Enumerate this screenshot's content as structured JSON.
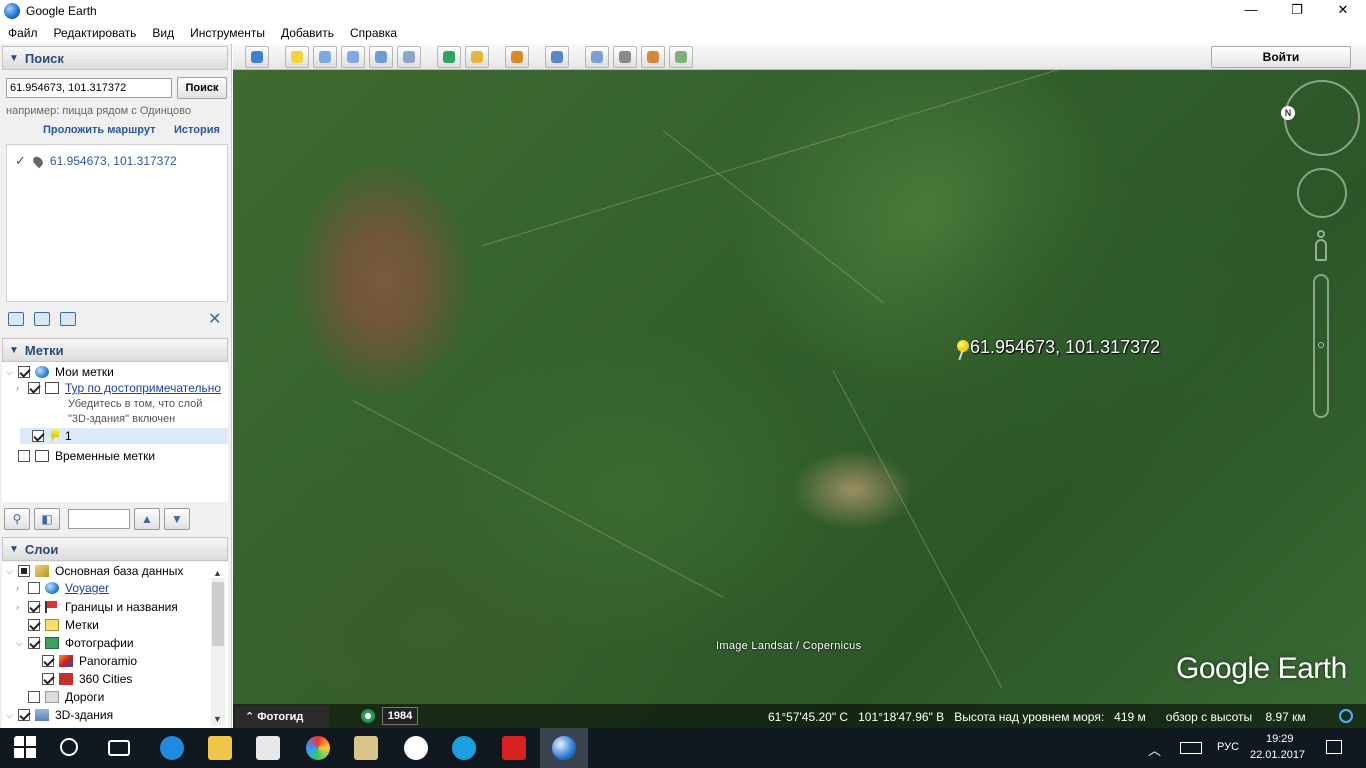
{
  "window": {
    "title": "Google Earth",
    "minimize": "—",
    "maximize": "❐",
    "close": "✕"
  },
  "menu": [
    "Файл",
    "Редактировать",
    "Вид",
    "Инструменты",
    "Добавить",
    "Справка"
  ],
  "search": {
    "header": "Поиск",
    "value": "61.954673, 101.317372",
    "button": "Поиск",
    "hint": "например: пицца рядом с Одинцово",
    "route_link": "Проложить маршрут",
    "history_link": "История",
    "result": "61.954673, 101.317372"
  },
  "places": {
    "header": "Метки",
    "my_places": "Мои метки",
    "tour_link": "Тур по достопримечательно",
    "tour_note_1": "Убедитесь в том, что слой",
    "tour_note_2": "\"3D-здания\" включен",
    "item_1": "1",
    "temporary": "Временные метки"
  },
  "layers": {
    "header": "Слои",
    "items": [
      "Основная база данных",
      "Voyager",
      "Границы и названия",
      "Метки",
      "Фотографии",
      "Panoramio",
      "360 Cities",
      "Дороги",
      "3D-здания"
    ]
  },
  "toolbar": {
    "login": "Войти"
  },
  "map": {
    "placemark_label": "61.954673, 101.317372",
    "attribution": "Image Landsat / Copernicus",
    "brand": "Google Earth",
    "north": "N"
  },
  "status": {
    "tour_guide": "⌃ Фотогид",
    "year": "1984",
    "lat": "61°57'45.20\" С",
    "lon": "101°18'47.96\" В",
    "elev_label": "Высота над уровнем моря:",
    "elev_value": "419 м",
    "eye_label": "обзор с высоты",
    "eye_value": "8.97 км"
  },
  "taskbar": {
    "lang": "РУС",
    "time": "19:29",
    "date": "22.01.2017"
  }
}
